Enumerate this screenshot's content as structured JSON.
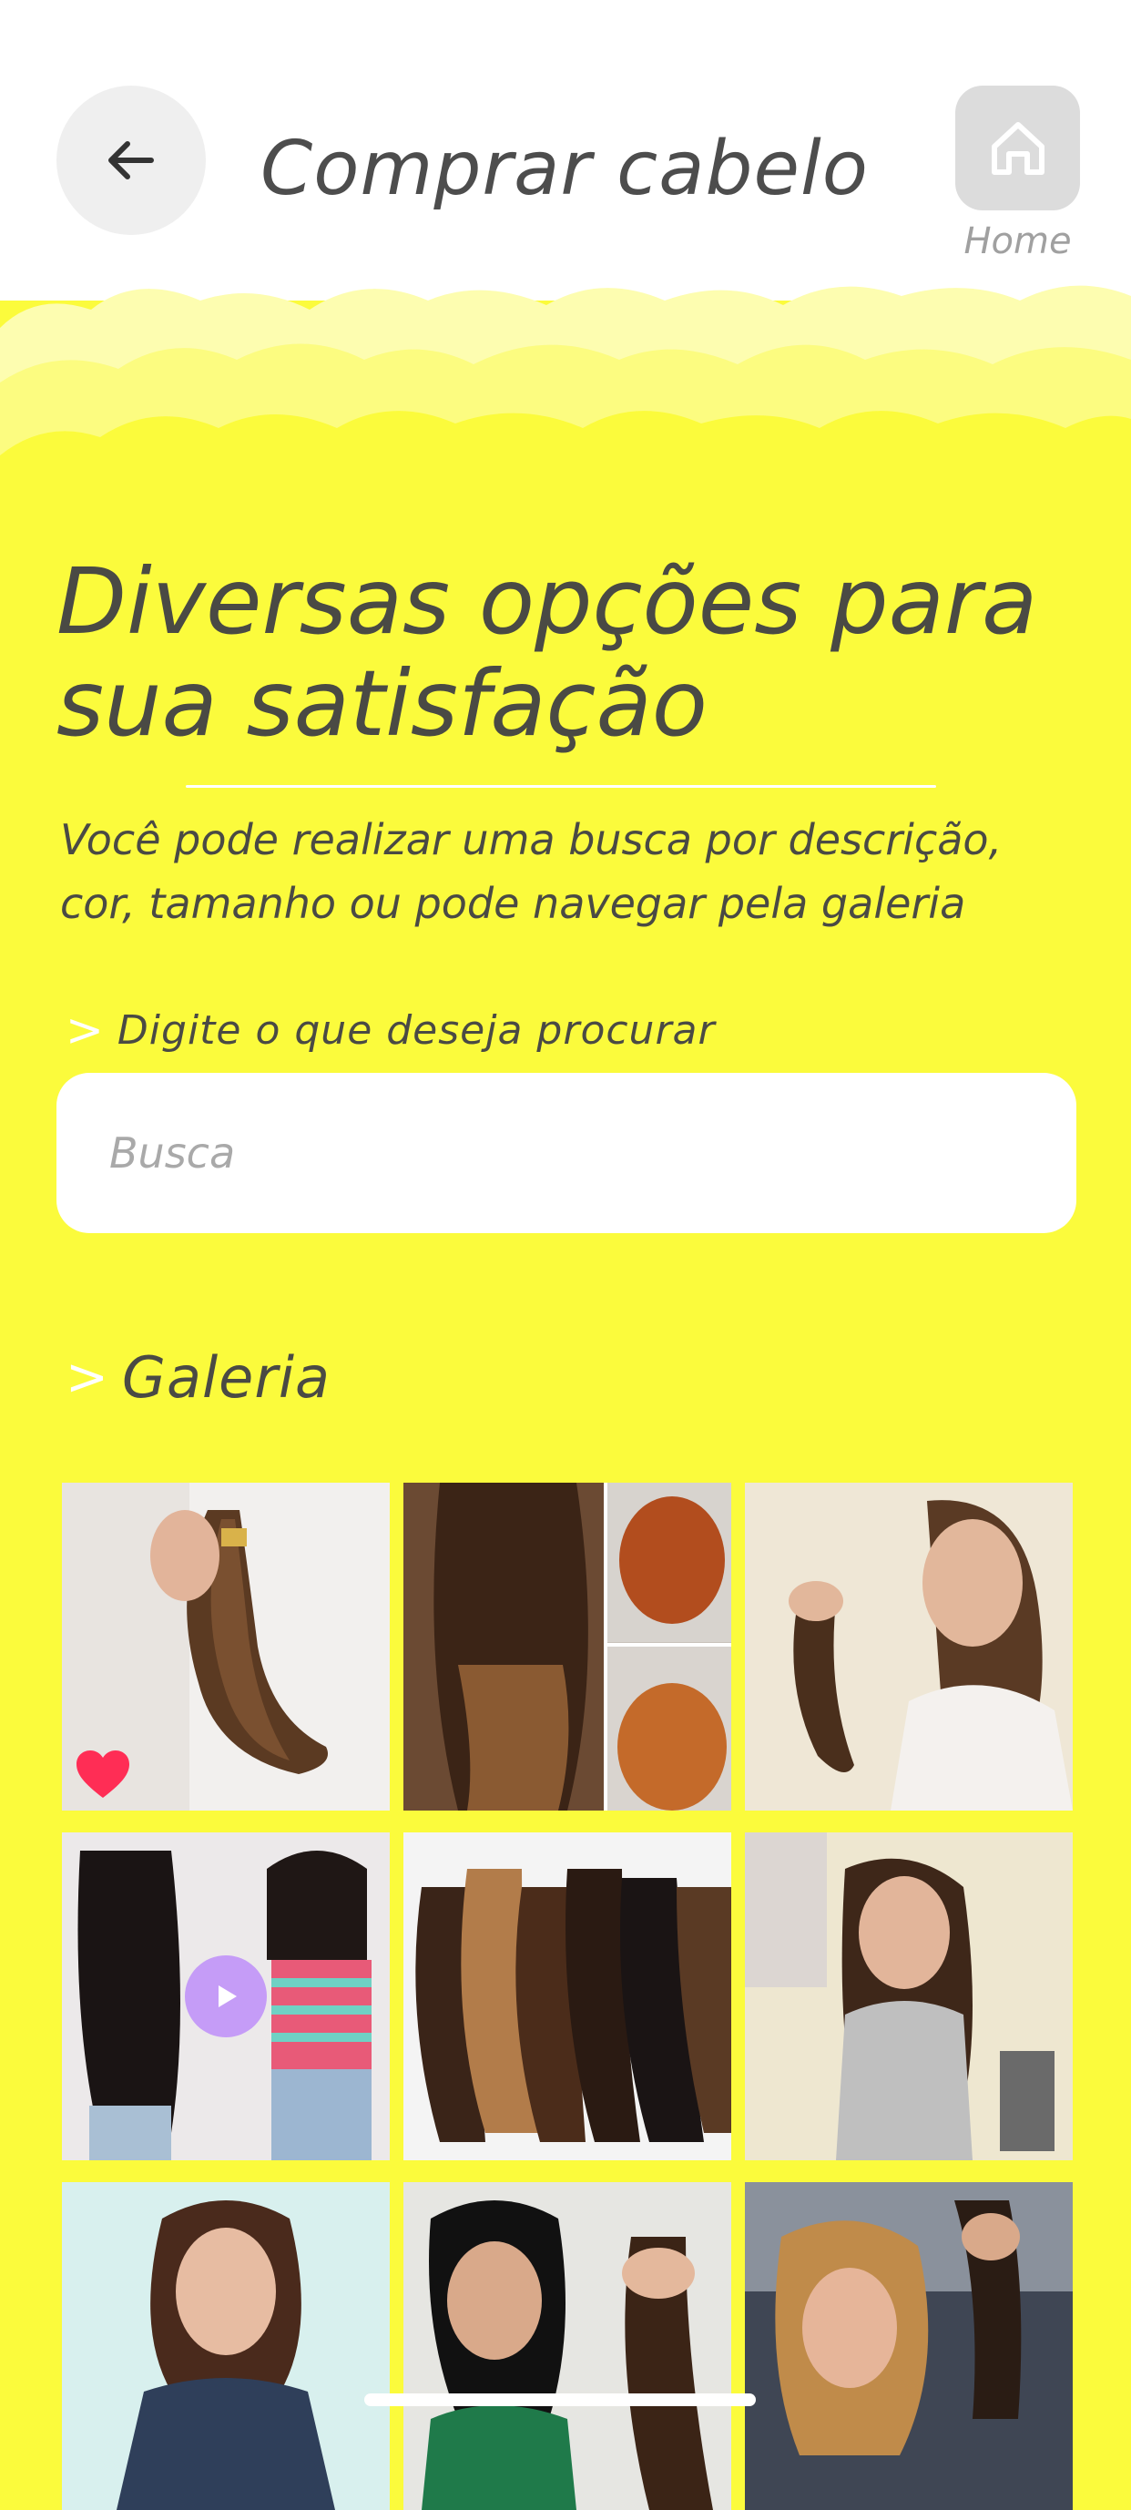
{
  "header": {
    "title": "Comprar cabelo",
    "back_icon": "arrow-left-icon",
    "home_icon": "home-icon",
    "home_label": "Home"
  },
  "main": {
    "headline": "Diversas opções para sua satisfação",
    "subtitle": "Você pode realizar uma busca por descrição, cor, tamanho ou pode navegar pela galeria",
    "search_label": "Digite o que deseja procurar",
    "search_placeholder": "Busca",
    "search_value": "",
    "gallery_label": "Galeria",
    "chevron": ">"
  },
  "gallery": {
    "items": [
      {
        "type": "photo",
        "favorite": true
      },
      {
        "type": "photo"
      },
      {
        "type": "photo"
      },
      {
        "type": "video"
      },
      {
        "type": "photo"
      },
      {
        "type": "photo"
      },
      {
        "type": "photo"
      },
      {
        "type": "photo"
      },
      {
        "type": "photo"
      }
    ]
  },
  "colors": {
    "background": "#fbfb3c",
    "header": "#ffffff",
    "favorite": "#ff2d55",
    "play_button": "#c59cf7",
    "text": "#4a4a44"
  }
}
